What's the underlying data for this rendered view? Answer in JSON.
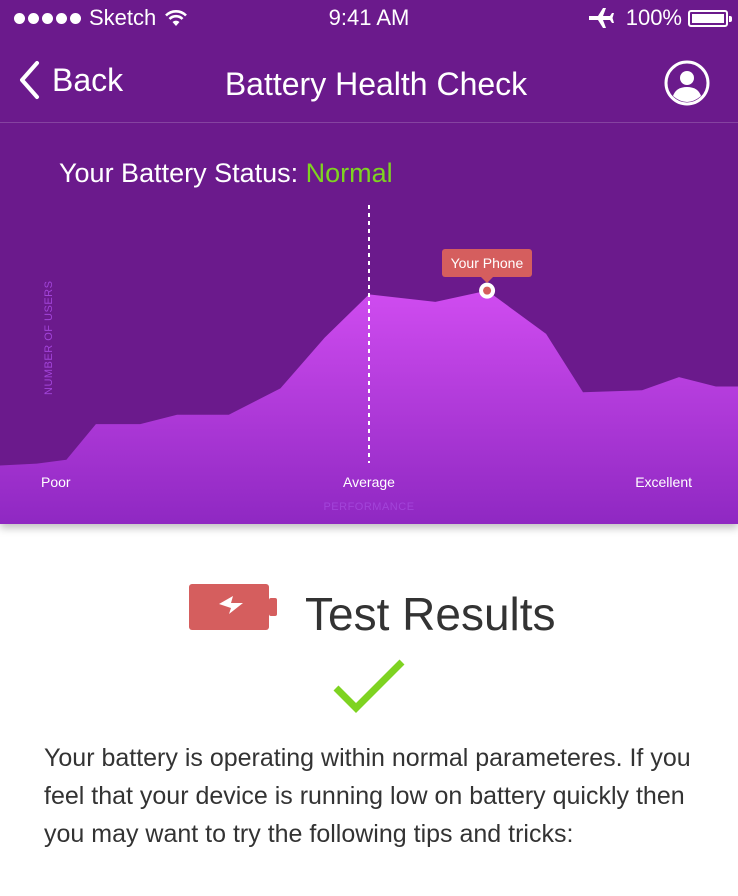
{
  "status_bar": {
    "carrier": "Sketch",
    "time": "9:41 AM",
    "battery_percent": "100%",
    "icons": [
      "signal-dots-icon",
      "wifi-icon",
      "airplane-icon",
      "battery-icon"
    ]
  },
  "nav": {
    "back_label": "Back",
    "title": "Battery Health Check",
    "profile_icon": "user-profile-icon"
  },
  "status": {
    "prefix": "Your Battery Status:",
    "value": "Normal",
    "value_color": "#7ed321"
  },
  "chart_data": {
    "type": "area",
    "xlabel": "PERFORMANCE",
    "ylabel": "NUMBER OF USERS",
    "tick_labels": [
      "Poor",
      "Average",
      "Excellent"
    ],
    "average_marker": "Average",
    "highlight": {
      "label": "Your Phone"
    },
    "x": [
      0,
      0.05,
      0.09,
      0.13,
      0.19,
      0.24,
      0.31,
      0.38,
      0.44,
      0.5,
      0.59,
      0.66,
      0.74,
      0.79,
      0.87,
      0.92,
      0.97,
      1.0
    ],
    "values": [
      0.04,
      0.05,
      0.07,
      0.26,
      0.26,
      0.31,
      0.31,
      0.45,
      0.72,
      0.95,
      0.91,
      0.97,
      0.74,
      0.43,
      0.44,
      0.51,
      0.46,
      0.46
    ],
    "highlight_index": 11,
    "average_index": 9,
    "ylim": [
      0,
      1
    ],
    "colors": {
      "fill_top": "#d04cf0",
      "fill_bottom": "#8f28c2",
      "marker": "#d55e5e"
    }
  },
  "results": {
    "title": "Test Results",
    "battery_icon": "battery-low-icon",
    "check_icon": "checkmark-icon",
    "description": "Your battery is operating within normal parameteres. If you feel that your device is running low on battery quickly then you may want to try the following tips and tricks:",
    "colors": {
      "battery": "#d55e5e",
      "check": "#7ed321"
    }
  }
}
